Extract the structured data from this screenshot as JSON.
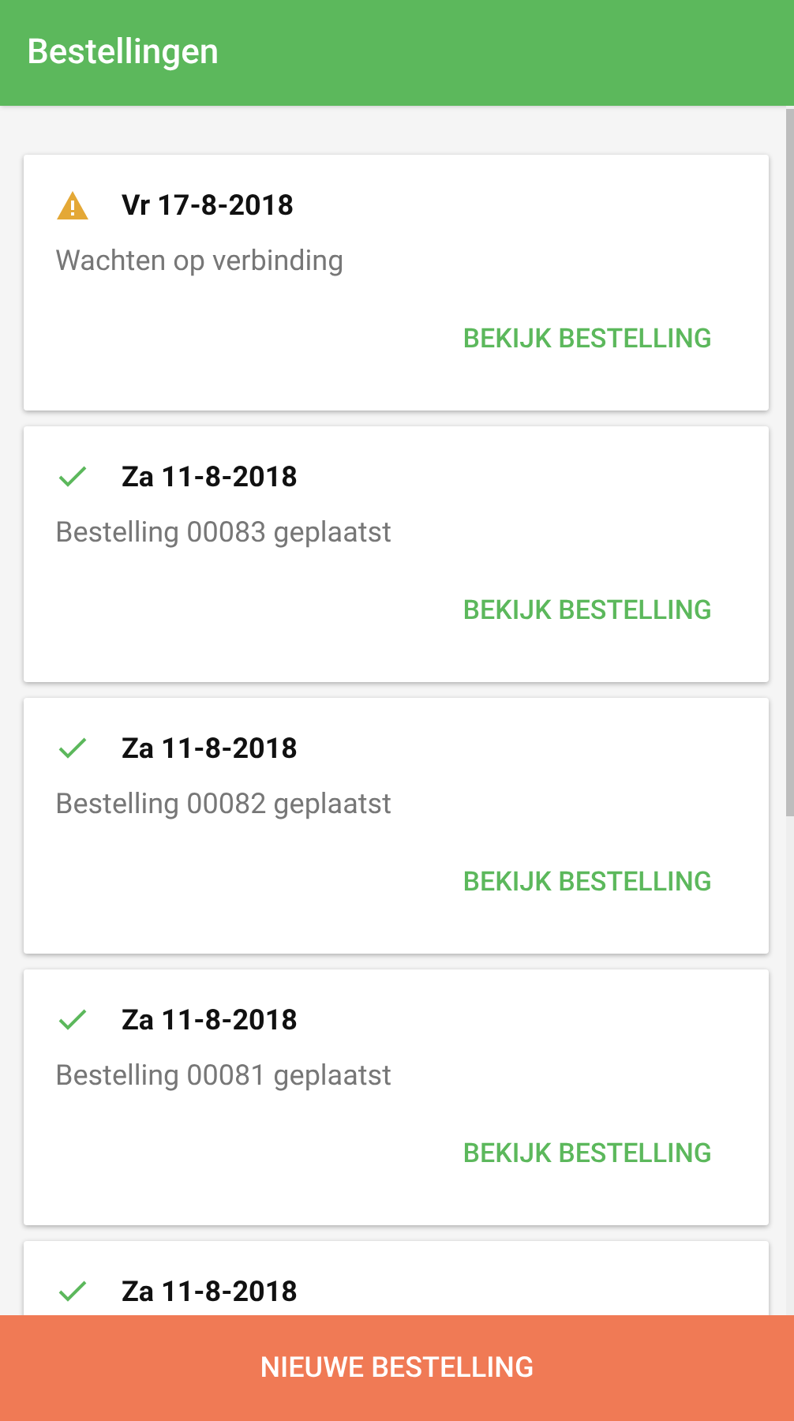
{
  "app_bar": {
    "title": "Bestellingen"
  },
  "orders": [
    {
      "kind": "warning",
      "date": "Vr 17-8-2018",
      "message": "Wachten op verbinding",
      "action": "BEKIJK BESTELLING"
    },
    {
      "kind": "ok",
      "date": "Za 11-8-2018",
      "message": "Bestelling 00083 geplaatst",
      "action": "BEKIJK BESTELLING"
    },
    {
      "kind": "ok",
      "date": "Za 11-8-2018",
      "message": "Bestelling 00082 geplaatst",
      "action": "BEKIJK BESTELLING"
    },
    {
      "kind": "ok",
      "date": "Za 11-8-2018",
      "message": "Bestelling 00081 geplaatst",
      "action": "BEKIJK BESTELLING"
    },
    {
      "kind": "ok",
      "date": "Za 11-8-2018"
    }
  ],
  "primary_button": "NIEUWE BESTELLING"
}
